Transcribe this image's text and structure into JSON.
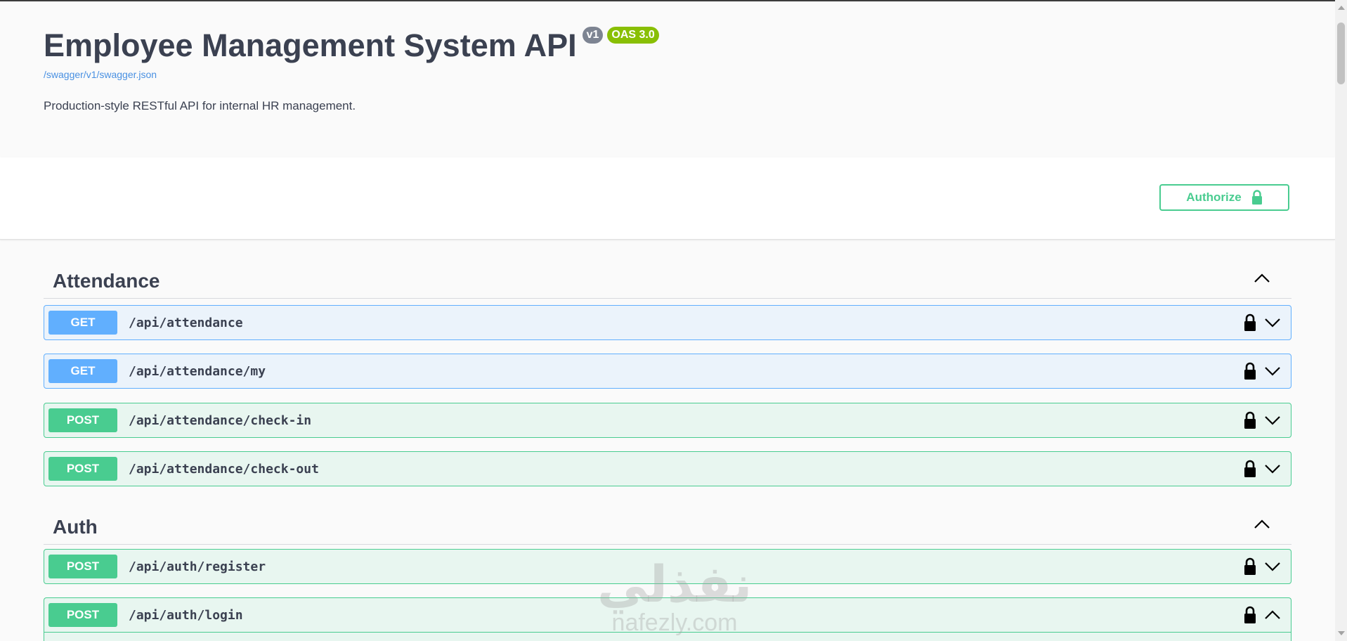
{
  "info": {
    "title": "Employee Management System API",
    "version_badge": "v1",
    "oas_badge": "OAS 3.0",
    "spec_link": "/swagger/v1/swagger.json",
    "description": "Production-style RESTful API for internal HR management."
  },
  "scheme": {
    "authorize_label": "Authorize",
    "authorize_icon": "lock-icon"
  },
  "tags": [
    {
      "name": "Attendance",
      "expanded": true,
      "operations": [
        {
          "method": "GET",
          "path": "/api/attendance",
          "locked": true,
          "expanded": false
        },
        {
          "method": "GET",
          "path": "/api/attendance/my",
          "locked": true,
          "expanded": false
        },
        {
          "method": "POST",
          "path": "/api/attendance/check-in",
          "locked": true,
          "expanded": false
        },
        {
          "method": "POST",
          "path": "/api/attendance/check-out",
          "locked": true,
          "expanded": false
        }
      ]
    },
    {
      "name": "Auth",
      "expanded": true,
      "operations": [
        {
          "method": "POST",
          "path": "/api/auth/register",
          "locked": true,
          "expanded": false
        },
        {
          "method": "POST",
          "path": "/api/auth/login",
          "locked": true,
          "expanded": true
        }
      ]
    }
  ],
  "colors": {
    "get": "#61affe",
    "post": "#49cc90",
    "text": "#3b4151",
    "link": "#4990e2",
    "version_badge": "#7d8492",
    "oas_badge": "#89bf04"
  },
  "watermark": {
    "arabic": "نفذلي",
    "latin": "nafezly.com"
  }
}
